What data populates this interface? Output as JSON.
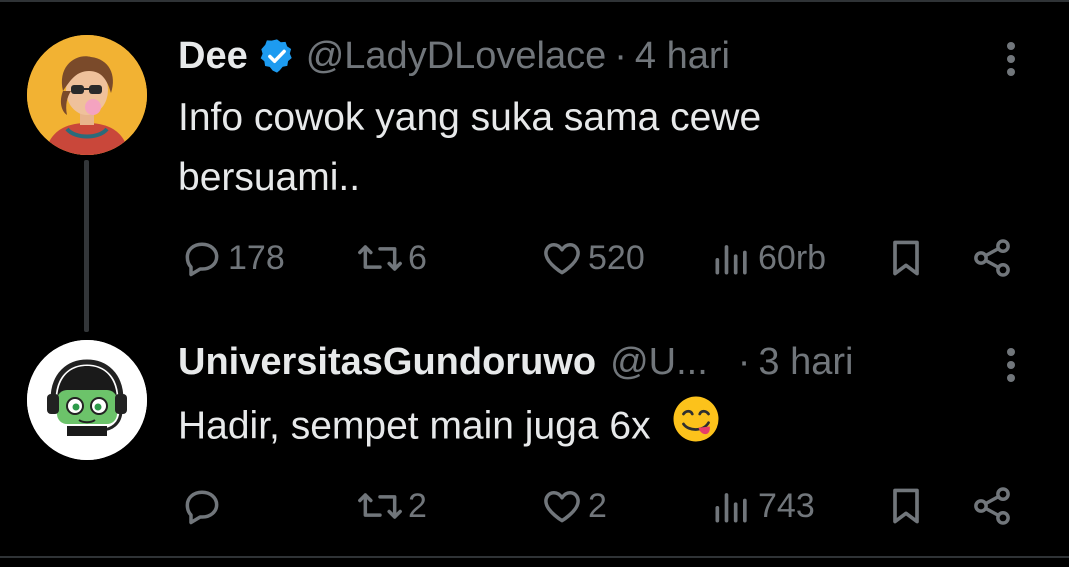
{
  "tweets": [
    {
      "name": "Dee",
      "handle": "@LadyDLovelace",
      "separator": "·",
      "time": "4 hari",
      "text_lines": [
        "Info cowok yang suka sama cewe",
        "bersuami.."
      ],
      "replies": "178",
      "retweets": "6",
      "likes": "520",
      "views": "60rb",
      "verified": true
    },
    {
      "name": "UniversitasGundoruwo",
      "handle": "@U...",
      "separator": "·",
      "time": "3 hari",
      "text": "Hadir, sempet main juga 6x",
      "emoji": "😋",
      "replies": "",
      "retweets": "2",
      "likes": "2",
      "views": "743",
      "verified": false
    }
  ],
  "icons": {
    "reply": "reply-icon",
    "retweet": "retweet-icon",
    "like": "heart-icon",
    "views": "views-icon",
    "bookmark": "bookmark-icon",
    "share": "share-icon",
    "more": "more-icon"
  },
  "colors": {
    "background": "#000000",
    "text": "#e7e9ea",
    "muted": "#71767b",
    "verified": "#1d9bf0"
  }
}
